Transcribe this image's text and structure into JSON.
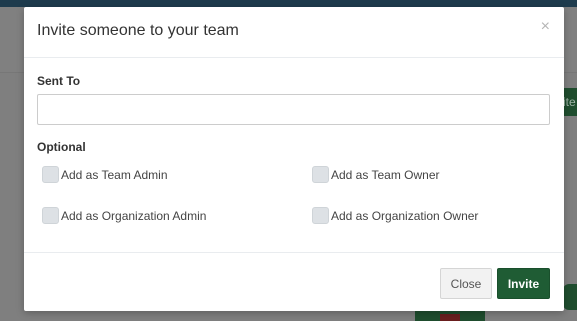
{
  "background": {
    "right_button_text": "ite"
  },
  "modal": {
    "title": "Invite someone to your team",
    "close_glyph": "×",
    "sent_to": {
      "label": "Sent To",
      "value": "",
      "placeholder": ""
    },
    "optional": {
      "label": "Optional",
      "options": [
        {
          "label": "Add as Team Admin",
          "checked": false
        },
        {
          "label": "Add as Team Owner",
          "checked": false
        },
        {
          "label": "Add as Organization Admin",
          "checked": false
        },
        {
          "label": "Add as Organization Owner",
          "checked": false
        }
      ]
    },
    "footer": {
      "close_label": "Close",
      "invite_label": "Invite"
    }
  },
  "colors": {
    "primary_green": "#1f5c34",
    "header_bar": "#1e3b4d",
    "overlay": "#7f7f7f"
  }
}
